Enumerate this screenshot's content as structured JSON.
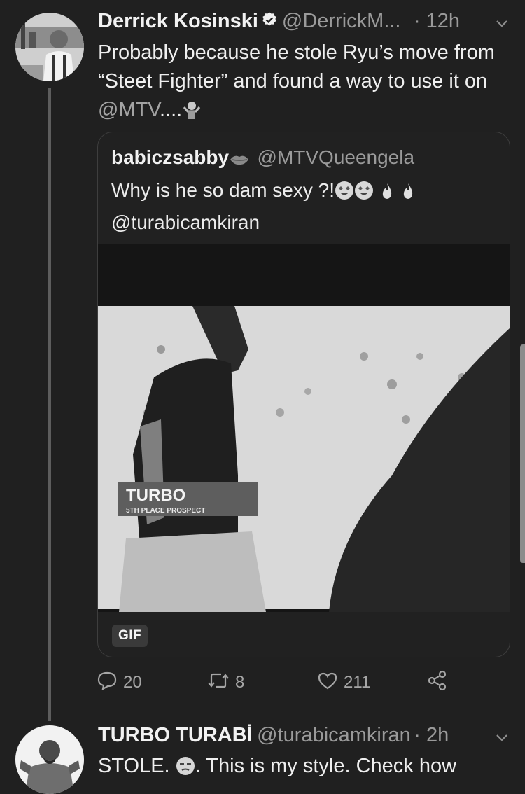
{
  "tweet1": {
    "name": "Derrick Kosinski",
    "handle": "@DerrickM...",
    "time": "· 12h",
    "text_part1": "Probably because he stole Ryu’s move from “Steet Fighter” and found a way to use it on ",
    "text_mention": "@MTV",
    "text_part2": "....",
    "quote": {
      "name": "babiczsabby",
      "handle": "@MTVQueengela",
      "text_line1": "Why is he so dam sexy ?!",
      "text_line2": "@turabicamkiran",
      "media_caption_title": "TURBO",
      "media_caption_sub": "5TH PLACE PROSPECT",
      "badge": "GIF"
    },
    "actions": {
      "replies": "20",
      "retweets": "8",
      "likes": "211"
    }
  },
  "tweet2": {
    "name": "TURBO TURABİ",
    "handle": "@turabicamkiran",
    "time": "· 2h",
    "text_part1": "STOLE. ",
    "text_part2": ". This is my style. Check how"
  },
  "colors": {
    "background": "#202020",
    "text": "#e9e9e9",
    "secondary": "#9a9a9a",
    "thread_line": "#5d5d5d"
  },
  "icons": [
    "verified-badge-icon",
    "chevron-down-icon",
    "lips-icon",
    "heart-eyes-emoji",
    "fire-emoji",
    "shrug-emoji",
    "reply-icon",
    "retweet-icon",
    "like-icon",
    "share-icon",
    "unamused-emoji"
  ]
}
